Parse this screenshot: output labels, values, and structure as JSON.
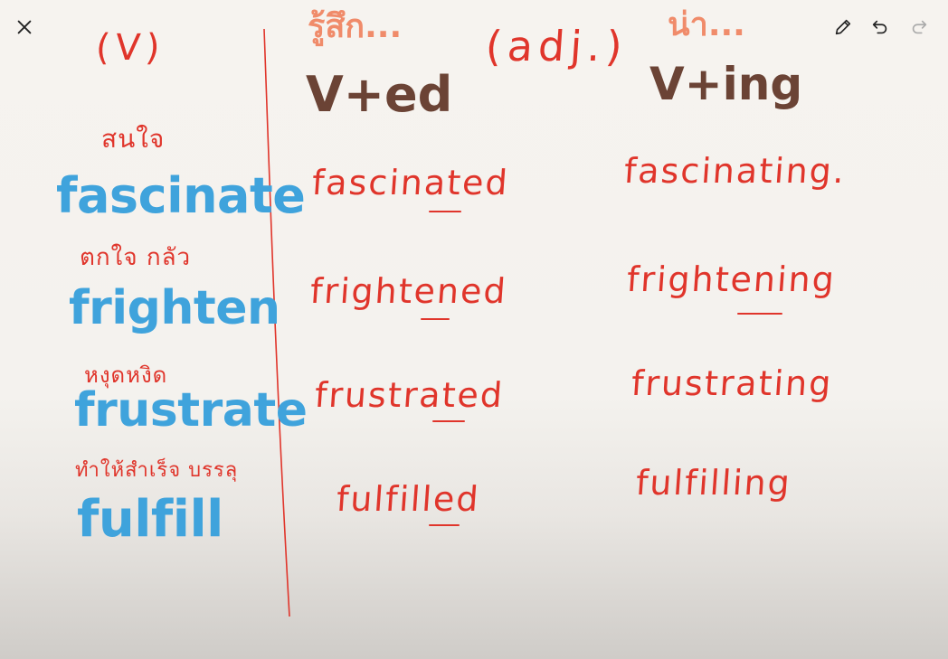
{
  "toolbar": {
    "close_icon": "close-icon",
    "pencil_icon": "pencil-icon",
    "undo_icon": "undo-icon",
    "redo_icon": "redo-icon"
  },
  "board": {
    "verb_header": "(V)",
    "adj_header": "(adj.)",
    "ed_heading_thai": "รู้สึก...",
    "ed_heading": "V+ed",
    "ing_heading_thai": "น่า...",
    "ing_heading": "V+ing",
    "verbs": [
      {
        "thai": "สนใจ",
        "verb": "fascinate",
        "ed": "fascinated",
        "ing": "fascinating."
      },
      {
        "thai": "ตกใจ กลัว",
        "verb": "frighten",
        "ed": "frightened",
        "ing": "frightening"
      },
      {
        "thai": "หงุดหงิด",
        "verb": "frustrate",
        "ed": "frustrated",
        "ing": "frustrating"
      },
      {
        "thai": "ทำให้สำเร็จ บรรลุ",
        "verb": "fulfill",
        "ed": "fulfilled",
        "ing": "fulfilling"
      }
    ]
  },
  "colors": {
    "ink_red": "#e0352b",
    "ink_blue": "#3fa3dc",
    "ink_brown": "#6b4335",
    "ink_orange": "#f08b6a"
  }
}
